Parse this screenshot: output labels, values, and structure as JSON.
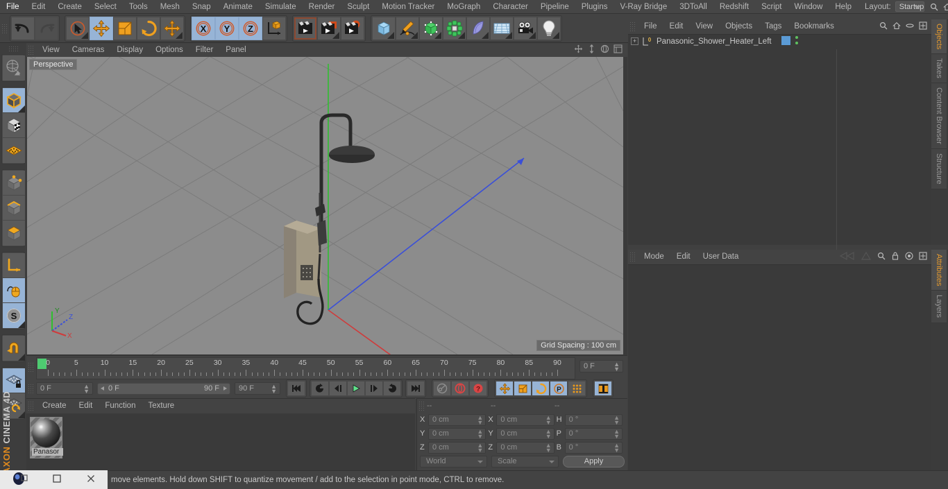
{
  "app": {
    "brand_top": "MAXON",
    "brand_bottom": "CINEMA 4D"
  },
  "menubar": {
    "items": [
      "File",
      "Edit",
      "Create",
      "Select",
      "Tools",
      "Mesh",
      "Snap",
      "Animate",
      "Simulate",
      "Render",
      "Sculpt",
      "Motion Tracker",
      "MoGraph",
      "Character",
      "Pipeline",
      "Plugins",
      "V-Ray Bridge",
      "3DToAll",
      "Redshift",
      "Script",
      "Window",
      "Help"
    ],
    "layout_label": "Layout:",
    "layout_value": "Startup",
    "icons": [
      "search-icon",
      "home-icon",
      "minimize-icon",
      "maximize-icon"
    ]
  },
  "toolbar": {
    "groups": [
      {
        "name": "history",
        "buttons": [
          {
            "name": "undo-button",
            "icon": "undo-arrow",
            "state": "normal"
          },
          {
            "name": "redo-button",
            "icon": "redo-arrow",
            "state": "disabled"
          }
        ]
      },
      {
        "name": "tools",
        "buttons": [
          {
            "name": "live-selection-tool",
            "icon": "cursor-circle",
            "state": "corner"
          },
          {
            "name": "move-tool",
            "icon": "move-arrows",
            "state": "selected"
          },
          {
            "name": "scale-tool",
            "icon": "scale-box",
            "state": "normal"
          },
          {
            "name": "rotate-tool",
            "icon": "rotate-circle",
            "state": "normal"
          },
          {
            "name": "transform-tool",
            "icon": "move-arrows",
            "state": "corner"
          }
        ]
      },
      {
        "name": "axis-locks",
        "buttons": [
          {
            "name": "lock-x-axis",
            "icon": "x-axis",
            "state": "selected",
            "label": "X"
          },
          {
            "name": "lock-y-axis",
            "icon": "y-axis",
            "state": "selected",
            "label": "Y"
          },
          {
            "name": "lock-z-axis",
            "icon": "z-axis",
            "state": "selected",
            "label": "Z"
          },
          {
            "name": "world-object-axis",
            "icon": "axis-cube",
            "state": "normal"
          }
        ]
      },
      {
        "name": "render",
        "buttons": [
          {
            "name": "render-view-button",
            "icon": "clapper-board",
            "state": "red-out"
          },
          {
            "name": "render-to-picture-viewer-button",
            "icon": "clapper-window",
            "state": "corner"
          },
          {
            "name": "render-settings-button",
            "icon": "clapper-gear",
            "state": "normal"
          }
        ]
      },
      {
        "name": "objects",
        "buttons": [
          {
            "name": "add-cube-button",
            "icon": "blue-cube",
            "state": "corner"
          },
          {
            "name": "add-spline-button",
            "icon": "pen-spline",
            "state": "corner"
          },
          {
            "name": "add-nurbs-button",
            "icon": "green-cage-cube",
            "state": "corner"
          },
          {
            "name": "add-array-button",
            "icon": "green-cluster",
            "state": "corner"
          },
          {
            "name": "add-bend-deformer-button",
            "icon": "purple-bend",
            "state": "corner"
          },
          {
            "name": "add-environment-button",
            "icon": "sky-grid",
            "state": "corner"
          },
          {
            "name": "add-camera-button",
            "icon": "camera",
            "state": "corner"
          },
          {
            "name": "add-light-button",
            "icon": "light-bulb",
            "state": "corner"
          }
        ]
      }
    ]
  },
  "left_toolbar": {
    "groups": [
      [
        {
          "name": "make-editable-button",
          "icon": "globe-wire"
        }
      ],
      [
        {
          "name": "model-mode-button",
          "icon": "orange-outline-cube",
          "state": "selected-corner"
        },
        {
          "name": "texture-mode-button",
          "icon": "checker-cube"
        },
        {
          "name": "workplane-mode-button",
          "icon": "orange-grid-plane"
        }
      ],
      [
        {
          "name": "points-mode-button",
          "icon": "cube-points"
        },
        {
          "name": "edges-mode-button",
          "icon": "cube-edges"
        },
        {
          "name": "polygons-mode-button",
          "icon": "cube-polygon"
        }
      ],
      [
        {
          "name": "object-axis-button",
          "icon": "orange-axis-l"
        },
        {
          "name": "enable-axis-modification-button",
          "icon": "mouse-axis",
          "state": "selected"
        },
        {
          "name": "soft-selection-button",
          "icon": "s-sphere",
          "state": "selected-corner"
        }
      ],
      [
        {
          "name": "snap-magnet-button",
          "icon": "orange-magnet",
          "state": "corner"
        }
      ],
      [
        {
          "name": "lock-workplane-button",
          "icon": "grid-lock",
          "state": "selected"
        },
        {
          "name": "planar-workplane-button",
          "icon": "grid-rotate",
          "state": "corner"
        }
      ]
    ]
  },
  "viewport": {
    "menu": [
      "View",
      "Cameras",
      "Display",
      "Options",
      "Filter",
      "Panel"
    ],
    "label": "Perspective",
    "grid_spacing": "Grid Spacing : 100 cm",
    "axis_gizmo": {
      "x": "X",
      "y": "Y",
      "z": "Z"
    },
    "icons": [
      "move-view-icon",
      "pan-view-icon",
      "rotate-view-icon",
      "maximize-view-icon"
    ],
    "colors": {
      "background": "#8c8c8c",
      "grid_line": "#7d7d7d",
      "y_axis": "#2fbf2f",
      "z_axis": "#3a4fd8",
      "x_axis": "#cf3b3b"
    }
  },
  "timeline": {
    "ruler_labels": [
      "0",
      "5",
      "10",
      "15",
      "20",
      "25",
      "30",
      "35",
      "40",
      "45",
      "50",
      "55",
      "60",
      "65",
      "70",
      "75",
      "80",
      "85",
      "90"
    ],
    "current_frame_field": "0 F",
    "start_frame_field": "0 F",
    "range_start": "0 F",
    "range_end": "90 F",
    "end_frame_field": "90 F",
    "playhead_frame": 0,
    "transport": [
      {
        "name": "go-to-start-button",
        "icon": "skip-start"
      },
      {
        "name": "previous-keyframe-button",
        "icon": "rewind-key"
      },
      {
        "name": "step-back-button",
        "icon": "step-back"
      },
      {
        "name": "play-button",
        "icon": "play-triangle"
      },
      {
        "name": "step-forward-button",
        "icon": "step-forward"
      },
      {
        "name": "next-keyframe-button",
        "icon": "forward-key"
      },
      {
        "name": "go-to-end-button",
        "icon": "skip-end"
      }
    ],
    "keys": [
      {
        "name": "record-active-objects-button",
        "icon": "key-grey"
      },
      {
        "name": "autokeying-button",
        "icon": "red-circle-arrows"
      },
      {
        "name": "keyframe-selection-button",
        "icon": "red-question"
      }
    ],
    "record_toggles": [
      {
        "name": "record-position-button",
        "icon": "move-arrows",
        "state": "selected"
      },
      {
        "name": "record-scale-button",
        "icon": "scale-box",
        "state": "selected"
      },
      {
        "name": "record-rotation-button",
        "icon": "rotate-circle",
        "state": "selected"
      },
      {
        "name": "record-pla-button",
        "icon": "p-circle",
        "state": "selected"
      },
      {
        "name": "record-parameter-button",
        "icon": "dot-matrix",
        "state": "normal"
      }
    ],
    "last_button": {
      "name": "timeline-filmstrip-button",
      "icon": "filmstrip",
      "state": "selected"
    }
  },
  "material_manager": {
    "menu": [
      "Create",
      "Edit",
      "Function",
      "Texture"
    ],
    "materials": [
      {
        "name": "Panasor",
        "selected": true
      }
    ]
  },
  "coordinates": {
    "header": [
      "--",
      "--",
      "--"
    ],
    "rows": [
      {
        "pos_label": "X",
        "pos_value": "0 cm",
        "size_label": "X",
        "size_value": "0 cm",
        "rot_label": "H",
        "rot_value": "0 °"
      },
      {
        "pos_label": "Y",
        "pos_value": "0 cm",
        "size_label": "Y",
        "size_value": "0 cm",
        "rot_label": "P",
        "rot_value": "0 °"
      },
      {
        "pos_label": "Z",
        "pos_value": "0 cm",
        "size_label": "Z",
        "size_value": "0 cm",
        "rot_label": "B",
        "rot_value": "0 °"
      }
    ],
    "system_combo": "World",
    "mode_combo": "Scale",
    "apply_label": "Apply"
  },
  "object_manager": {
    "menu": [
      "File",
      "Edit",
      "View",
      "Objects",
      "Tags",
      "Bookmarks"
    ],
    "icons": [
      "search-icon",
      "home-icon",
      "ellipse-icon",
      "expand-icon"
    ],
    "objects": [
      {
        "name": "Panasonic_Shower_Heater_Left",
        "layer_badge": "0",
        "tag_color": "#5b9bd5",
        "visibility_dots": "green"
      }
    ]
  },
  "attribute_manager": {
    "menu": [
      "Mode",
      "Edit",
      "User Data"
    ],
    "icons": [
      "back-icon",
      "forward-icon",
      "search-icon",
      "lock-icon",
      "target-icon",
      "expand-icon"
    ]
  },
  "right_tabs": {
    "top": [
      {
        "label": "Objects",
        "active": true
      },
      {
        "label": "Takes",
        "active": false
      },
      {
        "label": "Content Browser",
        "active": false
      },
      {
        "label": "Structure",
        "active": false
      }
    ],
    "bottom": [
      {
        "label": "Attributes",
        "active": true
      },
      {
        "label": "Layers",
        "active": false
      }
    ]
  },
  "statusbar": {
    "text": "move elements. Hold down SHIFT to quantize movement / add to the selection in point mode, CTRL to remove.",
    "window_controls": [
      "app-icon",
      "restore-icon",
      "maximize-icon",
      "close-icon"
    ]
  }
}
